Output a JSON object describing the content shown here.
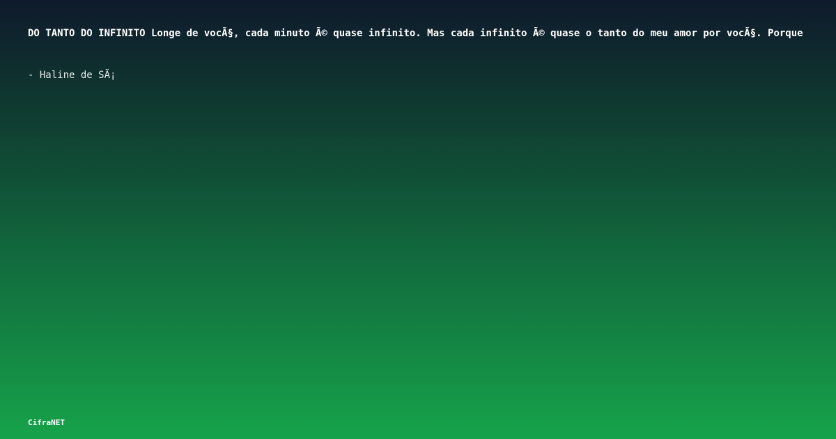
{
  "quote": {
    "text": "DO TANTO DO INFINITO Longe de vocÃ§, cada minuto Ã© quase infinito. Mas cada infinito Ã© quase o tanto do meu amor por vocÃ§. Porque"
  },
  "author": {
    "text": "- Haline de SÃ¡"
  },
  "brand": {
    "text": "CifraNET"
  }
}
